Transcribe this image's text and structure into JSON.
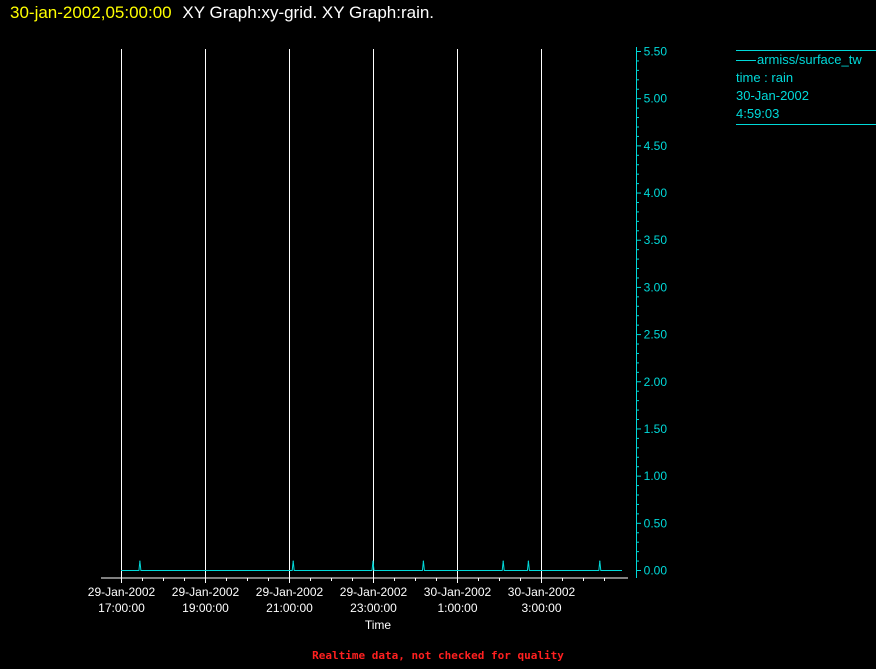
{
  "header": {
    "datetime": "30-jan-2002,05:00:00",
    "titles": "XY Graph:xy-grid.  XY Graph:rain."
  },
  "legend": {
    "series_name": "armiss/surface_tw",
    "variables": "time : rain",
    "date": "30-Jan-2002",
    "time": "4:59:03"
  },
  "footer": {
    "text": "Realtime data, not checked for quality"
  },
  "chart_data": {
    "type": "line",
    "xlabel": "Time",
    "ylabel": "",
    "x_ticks": [
      {
        "line1": "29-Jan-2002",
        "line2": "17:00:00",
        "hours": 0
      },
      {
        "line1": "29-Jan-2002",
        "line2": "19:00:00",
        "hours": 2
      },
      {
        "line1": "29-Jan-2002",
        "line2": "21:00:00",
        "hours": 4
      },
      {
        "line1": "29-Jan-2002",
        "line2": "23:00:00",
        "hours": 6
      },
      {
        "line1": "30-Jan-2002",
        "line2": "1:00:00",
        "hours": 8
      },
      {
        "line1": "30-Jan-2002",
        "line2": "3:00:00",
        "hours": 10
      }
    ],
    "y_ticks": [
      "0.00",
      "0.50",
      "1.00",
      "1.50",
      "2.00",
      "2.50",
      "3.00",
      "3.50",
      "4.00",
      "4.50",
      "5.00",
      "5.50"
    ],
    "ylim": [
      0,
      5.5
    ],
    "grid": "vertical",
    "axis_color": "#00d9d9",
    "series": [
      {
        "name": "armiss/surface_tw",
        "color": "#00d9d9",
        "x_hours": [
          0.45,
          4.1,
          6.0,
          7.2,
          9.1,
          9.7,
          11.4
        ],
        "values": [
          0.1,
          0.1,
          0.1,
          0.1,
          0.1,
          0.1,
          0.1
        ]
      }
    ]
  }
}
